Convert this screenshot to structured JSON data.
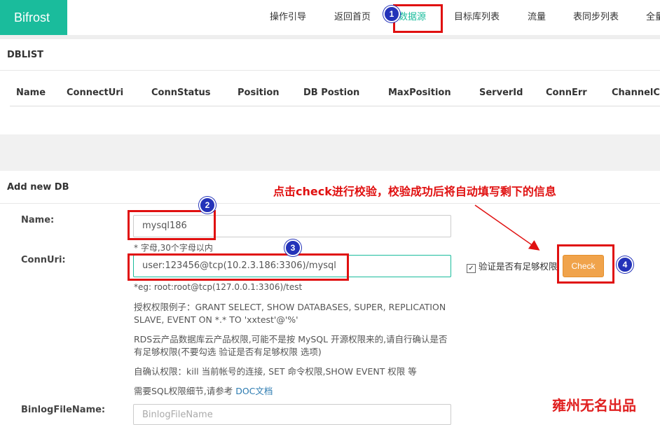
{
  "navbar": {
    "brand": "Bifrost",
    "items": [
      "操作引导",
      "返回首页",
      "数据源",
      "目标库列表",
      "流量",
      "表同步列表",
      "全量"
    ]
  },
  "dblist": {
    "title": "DBLIST",
    "columns": [
      "Name",
      "ConnectUri",
      "ConnStatus",
      "Position",
      "DB Postion",
      "MaxPosition",
      "ServerId",
      "ConnErr",
      "ChannelCo"
    ]
  },
  "add_new": {
    "title": "Add new DB",
    "name_label": "Name:",
    "name_value": "mysql186",
    "name_hint": "* 字母,30个字母以内",
    "connuri_label": "ConnUri:",
    "connuri_value": "user:123456@tcp(10.2.3.186:3306)/mysql",
    "connuri_eg": "*eg: root:root@tcp(127.0.0.1:3306)/test",
    "perm_example": "授权权限例子：GRANT SELECT, SHOW DATABASES, SUPER, REPLICATION SLAVE, EVENT ON *.* TO 'xxtest'@'%'",
    "rds_note": "RDS云产品数据库云产品权限,可能不是按 MySQL 开源权限来的,请自行确认是否有足够权限(不要勾选 验证是否有足够权限 选项)",
    "self_confirm": "自确认权限：kill 当前帐号的连接, SET 命令权限,SHOW EVENT 权限 等",
    "doc_prefix": "需要SQL权限细节,请参考 ",
    "doc_link": "DOC文档",
    "verify_label": "验证是否有足够权限",
    "verify_checked": true,
    "check_button": "Check",
    "binlog_label": "BinlogFileName:",
    "binlog_placeholder": "BinlogFileName"
  },
  "annotations": {
    "instruction": "点击check进行校验，校验成功后将自动填写剩下的信息",
    "badges": [
      "1",
      "2",
      "3",
      "4"
    ],
    "watermark": "雍州无名出品",
    "colors": {
      "annotation_red": "#e01010",
      "badge_blue": "#2433b9",
      "brand_teal": "#1abc9c",
      "check_orange": "#f0a34b"
    }
  }
}
